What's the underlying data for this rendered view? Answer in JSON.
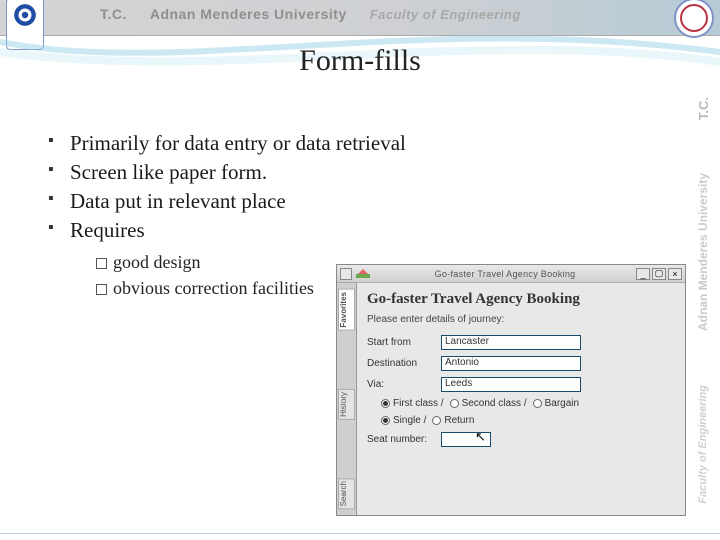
{
  "banner": {
    "tc": "T.C.",
    "uni": "Adnan Menderes University",
    "fac": "Faculty of Engineering"
  },
  "sidewm": {
    "tc": "T.C.",
    "uni": "Adnan Menderes University",
    "fac": "Faculty of Engineering"
  },
  "title": "Form-fills",
  "bullets": {
    "b1": "Primarily for data entry or data retrieval",
    "b2": "Screen like paper form.",
    "b3": "Data put in relevant place",
    "b4": "Requires",
    "s1": "good design",
    "s2": "obvious correction facilities"
  },
  "form": {
    "window_title": "Go-faster Travel Agency Booking",
    "heading": "Go-faster Travel Agency Booking",
    "prompt": "Please enter details of journey:",
    "labels": {
      "start": "Start from",
      "dest": "Destination",
      "via": "Via:",
      "seat": "Seat number:"
    },
    "values": {
      "start": "Lancaster",
      "dest": "Antonio",
      "via": "Leeds",
      "seat": ""
    },
    "radios": {
      "class": {
        "first": "First class",
        "second": "Second class",
        "bargain": "Bargain"
      },
      "trip": {
        "single": "Single",
        "return": "Return"
      }
    },
    "tabs": {
      "fav": "Favorites",
      "hist": "History",
      "search": "Search"
    }
  }
}
